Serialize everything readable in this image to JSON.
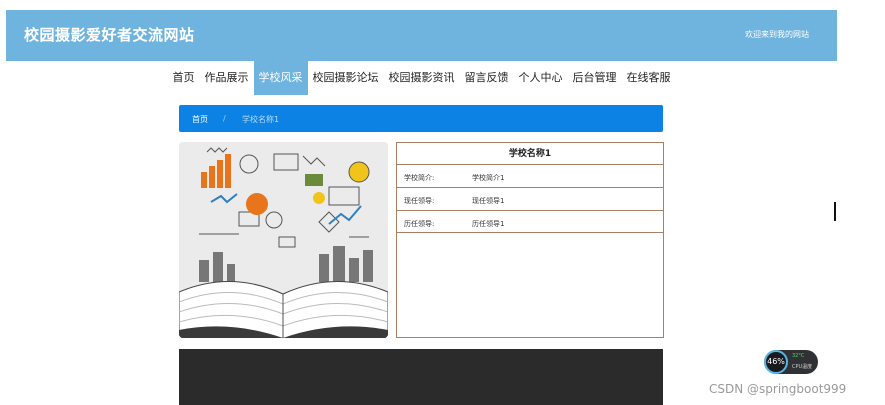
{
  "header": {
    "site_title": "校园摄影爱好者交流网站",
    "welcome": "欢迎来到我的网站"
  },
  "nav": {
    "items": [
      {
        "label": "首页"
      },
      {
        "label": "作品展示"
      },
      {
        "label": "学校风采",
        "active": true
      },
      {
        "label": "校园摄影论坛"
      },
      {
        "label": "校园摄影资讯"
      },
      {
        "label": "留言反馈"
      },
      {
        "label": "个人中心"
      },
      {
        "label": "后台管理"
      },
      {
        "label": "在线客服"
      }
    ]
  },
  "breadcrumb": {
    "home": "首页",
    "separator": "/",
    "current": "学校名称1"
  },
  "school": {
    "title": "学校名称1",
    "rows": [
      {
        "label": "学校简介:",
        "value": "学校简介1"
      },
      {
        "label": "现任领导:",
        "value": "现任领导1"
      },
      {
        "label": "历任领导:",
        "value": "历任领导1"
      }
    ]
  },
  "overlay": {
    "cpu_percent": "46%",
    "cpu_temp": "32°C",
    "cpu_label": "CPU温度",
    "watermark": "CSDN @springboot999"
  },
  "colors": {
    "header_bg": "#6fb3df",
    "breadcrumb_bg": "#0c82e4",
    "table_border": "#a88066",
    "footer_bg": "#2b2b2b"
  }
}
